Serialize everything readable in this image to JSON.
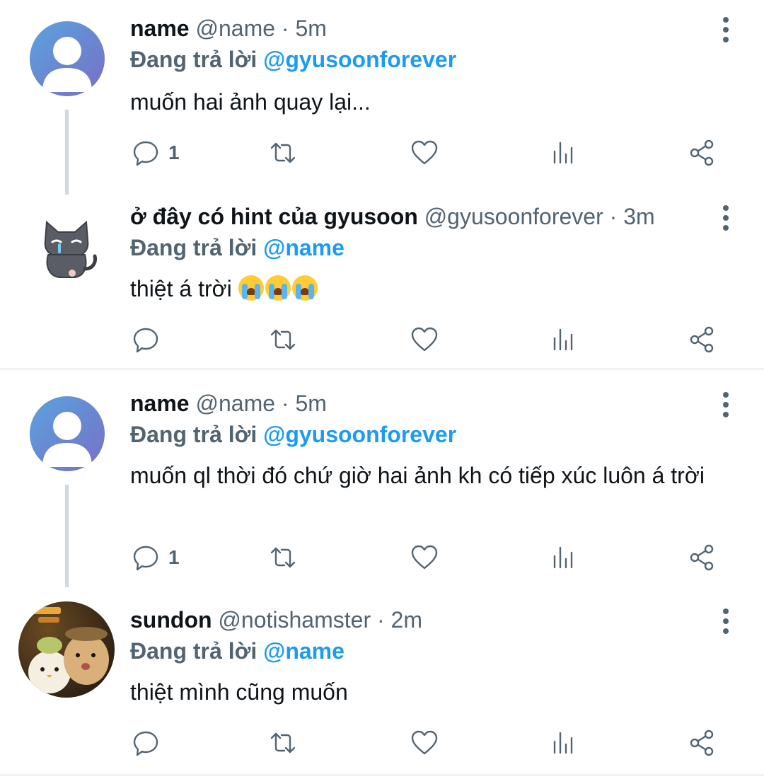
{
  "tweets": [
    {
      "name": "name",
      "handle": "@name",
      "time": "5m",
      "reply_prefix": "Đang trả lời",
      "reply_to": "@gyusoonforever",
      "text": "muốn hai ảnh quay lại...",
      "reply_count": "1"
    },
    {
      "name": "ở đây có hint của gyusoon",
      "handle": "@gyusoonforever",
      "time": "3m",
      "reply_prefix": "Đang trả lời",
      "reply_to": "@name",
      "text": "thiệt á trời",
      "emoji": "loudly-crying-face x3",
      "reply_count": ""
    },
    {
      "name": "name",
      "handle": "@name",
      "time": "5m",
      "reply_prefix": "Đang trả lời",
      "reply_to": "@gyusoonforever",
      "text": "muốn ql thời đó chứ giờ hai ảnh kh có tiếp xúc luôn á trời",
      "reply_count": "1"
    },
    {
      "name": "sundon",
      "handle": "@notishamster",
      "time": "2m",
      "reply_prefix": "Đang trả lời",
      "reply_to": "@name",
      "text": "thiệt mình cũng muốn",
      "reply_count": ""
    }
  ],
  "separator": "·",
  "icons": {
    "reply": "reply-icon",
    "retweet": "retweet-icon",
    "like": "heart-icon",
    "stats": "stats-icon",
    "share": "share-icon",
    "more": "more-icon"
  },
  "colors": {
    "mention": "#1d9bf0",
    "secondary": "#536471",
    "text": "#0f1419",
    "thread": "#cfd9de"
  }
}
